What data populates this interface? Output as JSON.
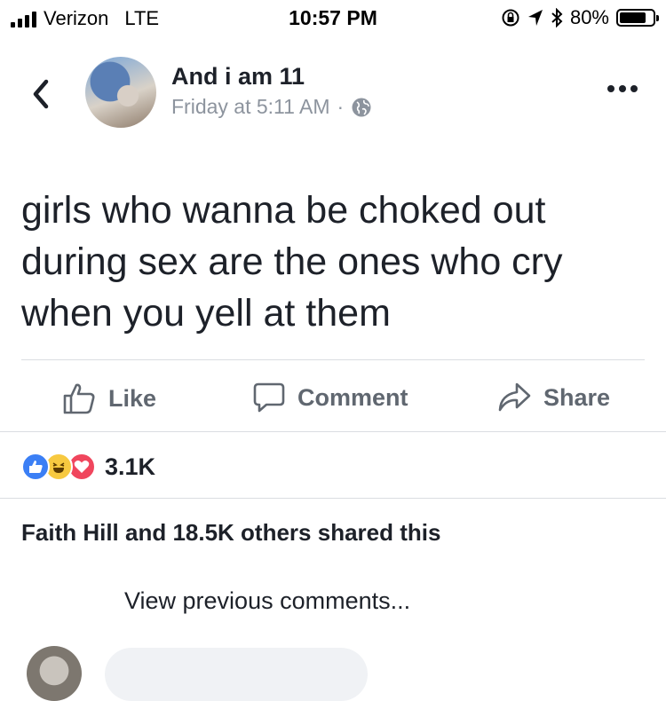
{
  "status_bar": {
    "carrier": "Verizon",
    "network": "LTE",
    "time": "10:57 PM",
    "battery": "80%",
    "battery_level": 0.8,
    "icons": [
      "rotation-lock-icon",
      "location-icon",
      "bluetooth-icon"
    ]
  },
  "post": {
    "author": "And i am 11",
    "timestamp": "Friday at 5:11 AM",
    "separator": "·",
    "privacy_icon": "globe-icon",
    "text_lines": [
      "girls who wanna be choked out",
      "during sex are the ones who cry",
      "when you yell at them"
    ]
  },
  "actions": {
    "like": "Like",
    "comment": "Comment",
    "share": "Share"
  },
  "reactions": {
    "types": [
      "like",
      "haha",
      "love"
    ],
    "count": "3.1K"
  },
  "shares": {
    "text": "Faith Hill and 18.5K others shared this"
  },
  "comments": {
    "view_previous": "View previous comments..."
  },
  "colors": {
    "text": "#1d2129",
    "secondary": "#8d949e",
    "action": "#606770",
    "like_blue": "#3b7ff5",
    "haha_yellow": "#f7c940",
    "love_red": "#f0465d",
    "divider": "#dadde1"
  }
}
